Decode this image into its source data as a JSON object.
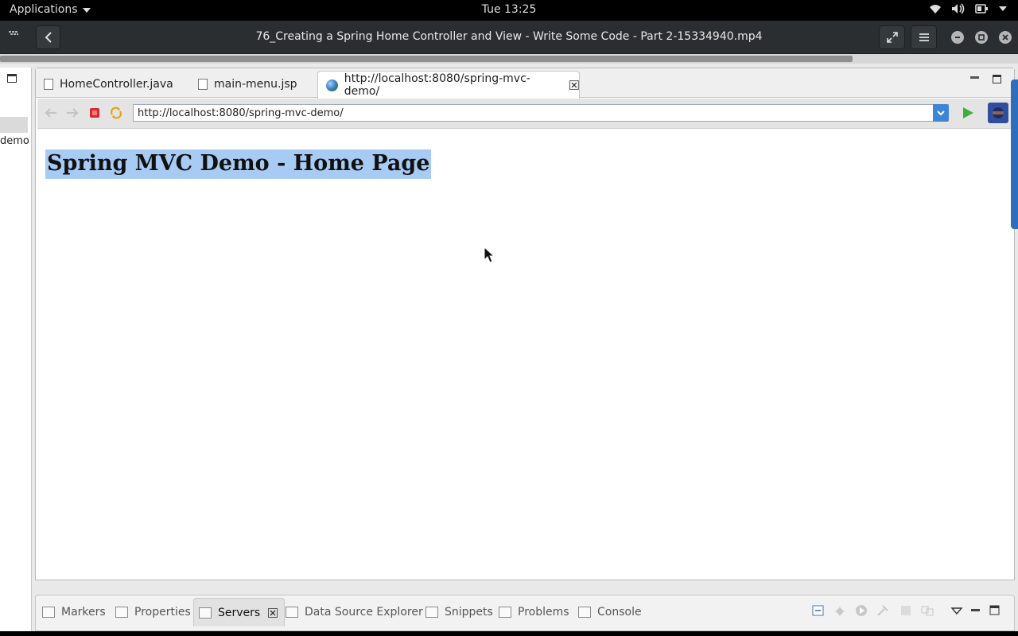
{
  "topbar": {
    "applications_label": "Applications",
    "clock": "Tue 13:25",
    "icons": [
      "wifi-icon",
      "volume-icon",
      "battery-icon",
      "chevron-down-icon"
    ]
  },
  "player": {
    "title": "76_Creating a Spring Home Controller and View - Write Some Code - Part 2-15334940.mp4"
  },
  "left_panel": {
    "partial_text": "demo"
  },
  "editor": {
    "tabs": [
      {
        "label": "HomeController.java",
        "icon": "java-file-icon"
      },
      {
        "label": "main-menu.jsp",
        "icon": "jsp-file-icon"
      },
      {
        "label": "http://localhost:8080/spring-mvc-demo/",
        "icon": "globe-icon",
        "active": true
      }
    ],
    "url": "http://localhost:8080/spring-mvc-demo/",
    "page_heading": "Spring MVC Demo - Home Page"
  },
  "bottom_panel": {
    "tabs": [
      {
        "label": "Markers"
      },
      {
        "label": "Properties"
      },
      {
        "label": "Servers",
        "active": true
      },
      {
        "label": "Data Source Explorer"
      },
      {
        "label": "Snippets"
      },
      {
        "label": "Problems"
      },
      {
        "label": "Console"
      }
    ]
  },
  "colors": {
    "selection": "#a8cbf4",
    "accent": "#3d85d6"
  }
}
